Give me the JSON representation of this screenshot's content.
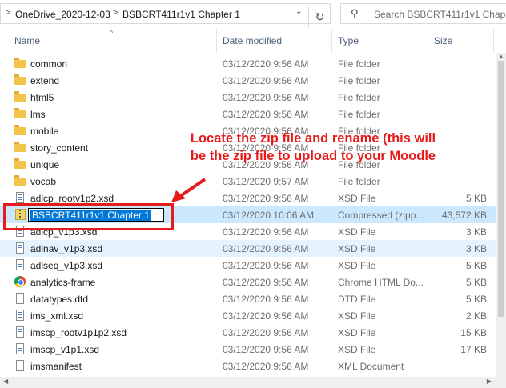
{
  "breadcrumb": {
    "parent": "OneDrive_2020-12-03",
    "current": "BSBCRT411r1v1 Chapter 1",
    "separator": ">"
  },
  "refresh_icon": "refresh-icon",
  "search": {
    "placeholder": "Search BSBCRT411r1v1 Chap..."
  },
  "columns": {
    "name": "Name",
    "date": "Date modified",
    "type": "Type",
    "size": "Size"
  },
  "rename_value": "BSBCRT411r1v1 Chapter 1",
  "annotation": {
    "line1": "Locate the zip file and rename (this will",
    "line2": "be the zip file to upload to your Moodle",
    "color": "#e51c1c"
  },
  "files": [
    {
      "name": "common",
      "date": "03/12/2020 9:56 AM",
      "type": "File folder",
      "size": "",
      "kind": "folder"
    },
    {
      "name": "extend",
      "date": "03/12/2020 9:56 AM",
      "type": "File folder",
      "size": "",
      "kind": "folder"
    },
    {
      "name": "html5",
      "date": "03/12/2020 9:56 AM",
      "type": "File folder",
      "size": "",
      "kind": "folder"
    },
    {
      "name": "lms",
      "date": "03/12/2020 9:56 AM",
      "type": "File folder",
      "size": "",
      "kind": "folder"
    },
    {
      "name": "mobile",
      "date": "03/12/2020 9:56 AM",
      "type": "File folder",
      "size": "",
      "kind": "folder"
    },
    {
      "name": "story_content",
      "date": "03/12/2020 9:56 AM",
      "type": "File folder",
      "size": "",
      "kind": "folder"
    },
    {
      "name": "unique",
      "date": "03/12/2020 9:56 AM",
      "type": "File folder",
      "size": "",
      "kind": "folder"
    },
    {
      "name": "vocab",
      "date": "03/12/2020 9:57 AM",
      "type": "File folder",
      "size": "",
      "kind": "folder"
    },
    {
      "name": "adlcp_rootv1p2.xsd",
      "date": "03/12/2020 9:56 AM",
      "type": "XSD File",
      "size": "5 KB",
      "kind": "xsd"
    },
    {
      "name": "",
      "date": "03/12/2020 10:06 AM",
      "type": "Compressed (zipp...",
      "size": "43,572 KB",
      "kind": "zip"
    },
    {
      "name": "adlcp_v1p3.xsd",
      "date": "03/12/2020 9:56 AM",
      "type": "XSD File",
      "size": "3 KB",
      "kind": "xsd"
    },
    {
      "name": "adlnav_v1p3.xsd",
      "date": "03/12/2020 9:56 AM",
      "type": "XSD File",
      "size": "3 KB",
      "kind": "xsd"
    },
    {
      "name": "adlseq_v1p3.xsd",
      "date": "03/12/2020 9:56 AM",
      "type": "XSD File",
      "size": "5 KB",
      "kind": "xsd"
    },
    {
      "name": "analytics-frame",
      "date": "03/12/2020 9:56 AM",
      "type": "Chrome HTML Do...",
      "size": "5 KB",
      "kind": "chrome"
    },
    {
      "name": "datatypes.dtd",
      "date": "03/12/2020 9:56 AM",
      "type": "DTD File",
      "size": "5 KB",
      "kind": "doc"
    },
    {
      "name": "ims_xml.xsd",
      "date": "03/12/2020 9:56 AM",
      "type": "XSD File",
      "size": "2 KB",
      "kind": "xsd"
    },
    {
      "name": "imscp_rootv1p1p2.xsd",
      "date": "03/12/2020 9:56 AM",
      "type": "XSD File",
      "size": "15 KB",
      "kind": "xsd"
    },
    {
      "name": "imscp_v1p1.xsd",
      "date": "03/12/2020 9:56 AM",
      "type": "XSD File",
      "size": "17 KB",
      "kind": "xsd"
    },
    {
      "name": "imsmanifest",
      "date": "03/12/2020 9:56 AM",
      "type": "XML Document",
      "size": "",
      "kind": "doc"
    }
  ]
}
